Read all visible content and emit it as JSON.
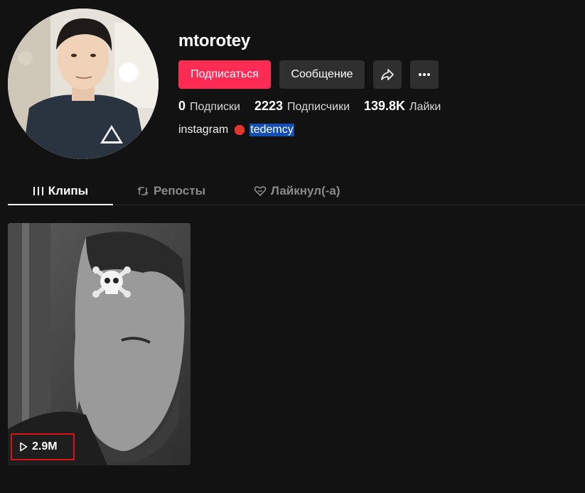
{
  "profile": {
    "username": "mtorotey",
    "avatar_alt": "profile avatar"
  },
  "actions": {
    "follow_label": "Подписаться",
    "message_label": "Сообщение",
    "share_icon": "share-icon",
    "more_icon": "more-icon"
  },
  "stats": {
    "following_count": "0",
    "following_label": "Подписки",
    "followers_count": "2223",
    "followers_label": "Подписчики",
    "likes_count": "139.8K",
    "likes_label": "Лайки"
  },
  "bio": {
    "text": "instagram",
    "emoji_icon": "stop-sign-icon",
    "link_text": "tedemcy"
  },
  "tabs": [
    {
      "label": "Клипы",
      "icon": "grid-lines-icon",
      "active": true
    },
    {
      "label": "Репосты",
      "icon": "repost-icon",
      "active": false
    },
    {
      "label": "Лайкнул(-а)",
      "icon": "heart-icon",
      "active": false
    }
  ],
  "videos": [
    {
      "views": "2.9M",
      "overlay_emoji": "skull-and-crossbones-icon"
    }
  ],
  "colors": {
    "background": "#121212",
    "accent": "#fe2c55",
    "secondary_button": "#2f2f2f",
    "highlight_box": "#d4141a",
    "link_highlight": "#1450b4"
  }
}
